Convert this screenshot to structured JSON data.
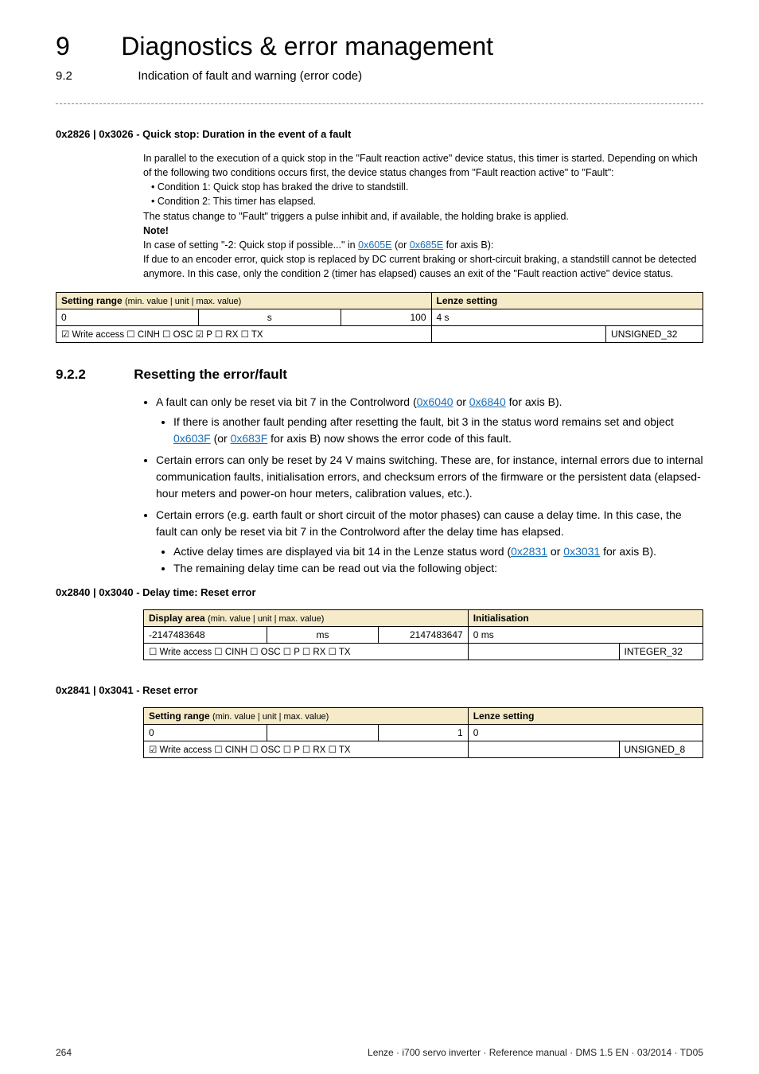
{
  "header": {
    "chapter_num": "9",
    "chapter_title": "Diagnostics & error management",
    "sub_num": "9.2",
    "sub_title": "Indication of fault and warning (error code)"
  },
  "p1": {
    "heading": "0x2826 | 0x3026 - Quick stop: Duration in the event of a fault",
    "d1": "In parallel to the execution of a quick stop in the \"Fault reaction active\" device status, this timer is started. Depending on which of the following two conditions occurs first, the device status changes from \"Fault reaction active\" to \"Fault\":",
    "b1": "• Condition 1: Quick stop has braked the drive to standstill.",
    "b2": "• Condition 2: This timer has elapsed.",
    "d2": "The status change to \"Fault\" triggers a pulse inhibit and, if available, the holding brake is applied.",
    "note": "Note!",
    "d3a": "In case of setting \"-2: Quick stop if possible...\" in ",
    "link1": "0x605E",
    "d3b": " (or ",
    "link2": "0x685E",
    "d3c": " for axis B):",
    "d4": "If due to an encoder error, quick stop is replaced by DC current braking or short-circuit braking, a standstill cannot be detected anymore. In this case, only the condition 2 (timer has elapsed) causes an exit of the \"Fault reaction active\" device status.",
    "table": {
      "hdr_left": "Setting range ",
      "hdr_left_sub": "(min. value | unit | max. value)",
      "hdr_right": "Lenze setting",
      "min": "0",
      "unit": "s",
      "max": "100",
      "setting": "4 s",
      "access": "☑ Write access  ☐ CINH  ☐ OSC  ☑ P  ☐ RX  ☐ TX",
      "dtype": "UNSIGNED_32"
    }
  },
  "sec": {
    "num": "9.2.2",
    "title": "Resetting the error/fault",
    "li1a": "A fault can only be reset via bit 7 in the Controlword (",
    "li1_link1": "0x6040",
    "li1b": " or ",
    "li1_link2": "0x6840",
    "li1c": " for axis B).",
    "li1s1a": "If there is another fault pending after resetting the fault, bit 3 in the status word remains set and object ",
    "li1s1_link1": "0x603F",
    "li1s1b": " (or ",
    "li1s1_link2": "0x683F",
    "li1s1c": " for axis B) now shows the error code of this fault.",
    "li2": "Certain errors can only be reset by 24 V mains switching. These are, for instance, internal errors due to internal communication faults, initialisation errors, and checksum errors of the firmware or the persistent data (elapsed-hour meters and power-on hour meters, calibration values, etc.).",
    "li3": "Certain errors (e.g. earth fault or short circuit of the motor phases) can cause a delay time. In this case, the fault can only be reset via bit 7 in the Controlword after the delay time has elapsed.",
    "li3s1a": "Active delay times are displayed via bit 14 in the Lenze status word (",
    "li3s1_link1": "0x2831",
    "li3s1b": " or ",
    "li3s1_link2": "0x3031",
    "li3s1c": " for axis B).",
    "li3s2": "The remaining delay time can be read out via the following object:"
  },
  "p2": {
    "heading": "0x2840 | 0x3040 - Delay time: Reset error",
    "table": {
      "hdr_left": "Display area ",
      "hdr_left_sub": "(min. value | unit | max. value)",
      "hdr_right": "Initialisation",
      "min": "-2147483648",
      "unit": "ms",
      "max": "2147483647",
      "setting": "0 ms",
      "access": "☐ Write access  ☐ CINH  ☐ OSC  ☐ P  ☐ RX  ☐ TX",
      "dtype": "INTEGER_32"
    }
  },
  "p3": {
    "heading": "0x2841 | 0x3041 - Reset error",
    "table": {
      "hdr_left": "Setting range ",
      "hdr_left_sub": "(min. value | unit | max. value)",
      "hdr_right": "Lenze setting",
      "min": "0",
      "unit": "",
      "max": "1",
      "setting": "0",
      "access": "☑ Write access  ☐ CINH  ☐ OSC  ☐ P  ☐ RX  ☐ TX",
      "dtype": "UNSIGNED_8"
    }
  },
  "footer": {
    "page": "264",
    "legal": "Lenze · i700 servo inverter · Reference manual · DMS 1.5 EN · 03/2014 · TD05"
  }
}
